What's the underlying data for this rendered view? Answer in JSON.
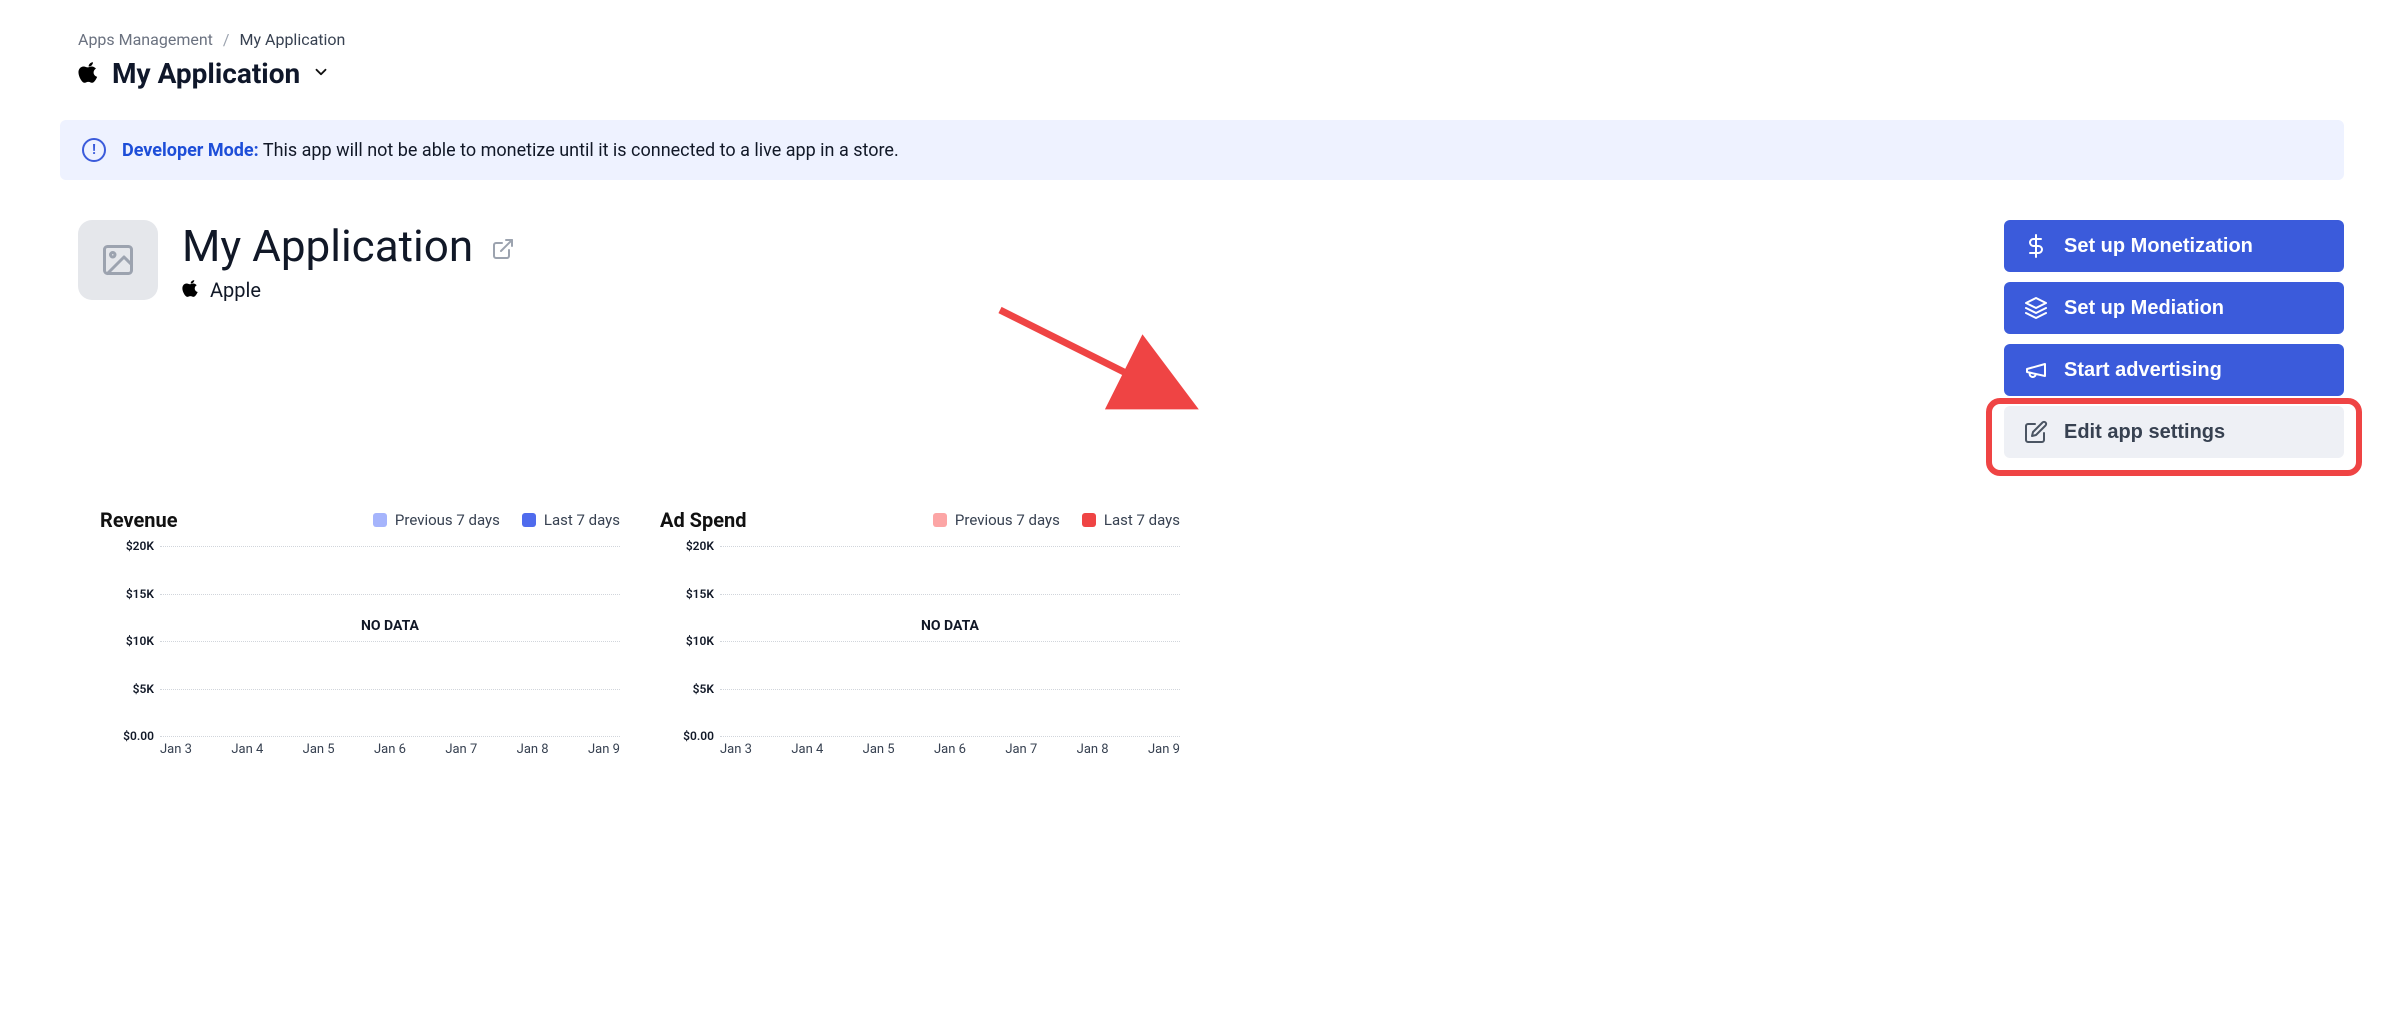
{
  "breadcrumb": {
    "root": "Apps Management",
    "current": "My Application"
  },
  "app_switcher": {
    "title": "My Application"
  },
  "banner": {
    "label": "Developer Mode:",
    "message": "This app will not be able to monetize until it is connected to a live app in a store."
  },
  "app": {
    "name": "My Application",
    "platform": "Apple"
  },
  "actions": {
    "monetization": "Set up Monetization",
    "mediation": "Set up Mediation",
    "advertising": "Start advertising",
    "edit": "Edit app settings"
  },
  "legend": {
    "previous": "Previous 7 days",
    "last": "Last 7 days"
  },
  "colors": {
    "revenue_prev": "#a5b4fc",
    "revenue_last": "#4f6bed",
    "spend_prev": "#fca5a5",
    "spend_last": "#ef4444"
  },
  "charts": {
    "revenue": {
      "title": "Revenue",
      "no_data": "NO DATA"
    },
    "adspend": {
      "title": "Ad Spend",
      "no_data": "NO DATA"
    }
  },
  "chart_data": [
    {
      "type": "line",
      "title": "Revenue",
      "categories": [
        "Jan 3",
        "Jan 4",
        "Jan 5",
        "Jan 6",
        "Jan 7",
        "Jan 8",
        "Jan 9"
      ],
      "series": [
        {
          "name": "Previous 7 days",
          "values": [
            null,
            null,
            null,
            null,
            null,
            null,
            null
          ]
        },
        {
          "name": "Last 7 days",
          "values": [
            null,
            null,
            null,
            null,
            null,
            null,
            null
          ]
        }
      ],
      "y_ticks": [
        "$20K",
        "$15K",
        "$10K",
        "$5K",
        "$0.00"
      ],
      "ylim": [
        0,
        20000
      ],
      "no_data": true
    },
    {
      "type": "line",
      "title": "Ad Spend",
      "categories": [
        "Jan 3",
        "Jan 4",
        "Jan 5",
        "Jan 6",
        "Jan 7",
        "Jan 8",
        "Jan 9"
      ],
      "series": [
        {
          "name": "Previous 7 days",
          "values": [
            null,
            null,
            null,
            null,
            null,
            null,
            null
          ]
        },
        {
          "name": "Last 7 days",
          "values": [
            null,
            null,
            null,
            null,
            null,
            null,
            null
          ]
        }
      ],
      "y_ticks": [
        "$20K",
        "$15K",
        "$10K",
        "$5K",
        "$0.00"
      ],
      "ylim": [
        0,
        20000
      ],
      "no_data": true
    }
  ]
}
